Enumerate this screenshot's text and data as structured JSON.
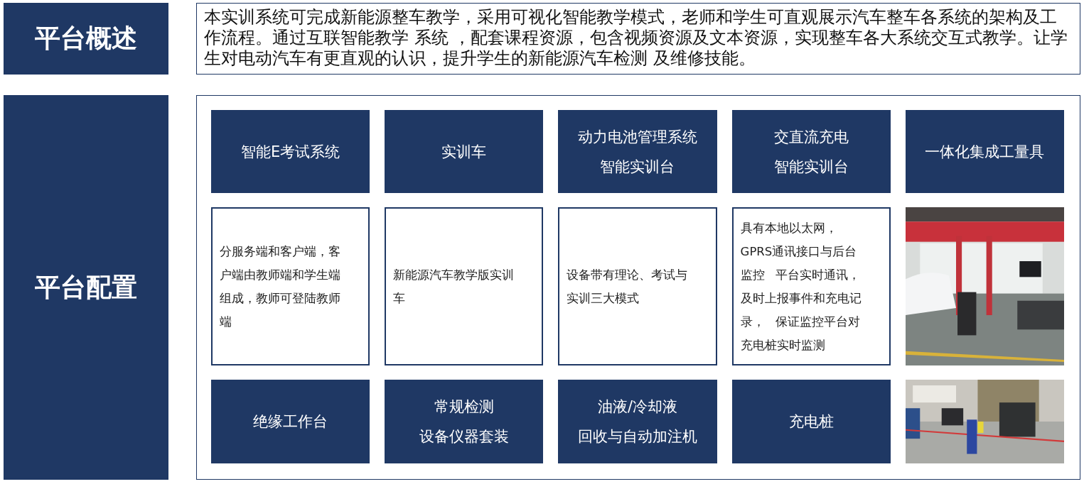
{
  "overview": {
    "label": "平台概述",
    "text": "本实训系统可完成新能源整车教学，采用可视化智能教学模式，老师和学生可直观展示汽车整车各系统的架构及工作流程。通过互联智能教学 系统 ，配套课程资源，包含视频资源及文本资源，实现整车各大系统交互式教学。让学生对电动汽车有更直观的认识，提升学生的新能源汽车检测 及维修技能。"
  },
  "config": {
    "label": "平台配置",
    "cells": [
      {
        "kind": "tile",
        "lines": [
          "智能E考试系统"
        ]
      },
      {
        "kind": "tile",
        "lines": [
          "实训车"
        ]
      },
      {
        "kind": "tile",
        "lines": [
          "动力电池管理系统",
          "智能实训台"
        ]
      },
      {
        "kind": "tile",
        "lines": [
          "交直流充电",
          "智能实训台"
        ]
      },
      {
        "kind": "tile",
        "lines": [
          "一体化集成工量具"
        ]
      },
      {
        "kind": "text",
        "text": "分服务端和客户端，客户端由教师端和学生端组成，教师可登陆教师端"
      },
      {
        "kind": "text",
        "text": "新能源汽车教学版实训车"
      },
      {
        "kind": "text",
        "text": "设备带有理论、考试与实训三大模式"
      },
      {
        "kind": "text",
        "text": "具有本地以太网，GPRS通讯接口与后台监控   平台实时通讯，及时上报事件和充电记录，   保证监控平台对充电桩实时监测"
      },
      {
        "kind": "picture"
      },
      {
        "kind": "tile",
        "lines": [
          "绝缘工作台"
        ]
      },
      {
        "kind": "tile",
        "lines": [
          "常规检测",
          "设备仪器套装"
        ]
      },
      {
        "kind": "tile",
        "lines": [
          "油液/冷却液",
          "回收与自动加注机"
        ]
      },
      {
        "kind": "tile",
        "lines": [
          "充电桩"
        ]
      },
      {
        "kind": "picture"
      }
    ]
  }
}
